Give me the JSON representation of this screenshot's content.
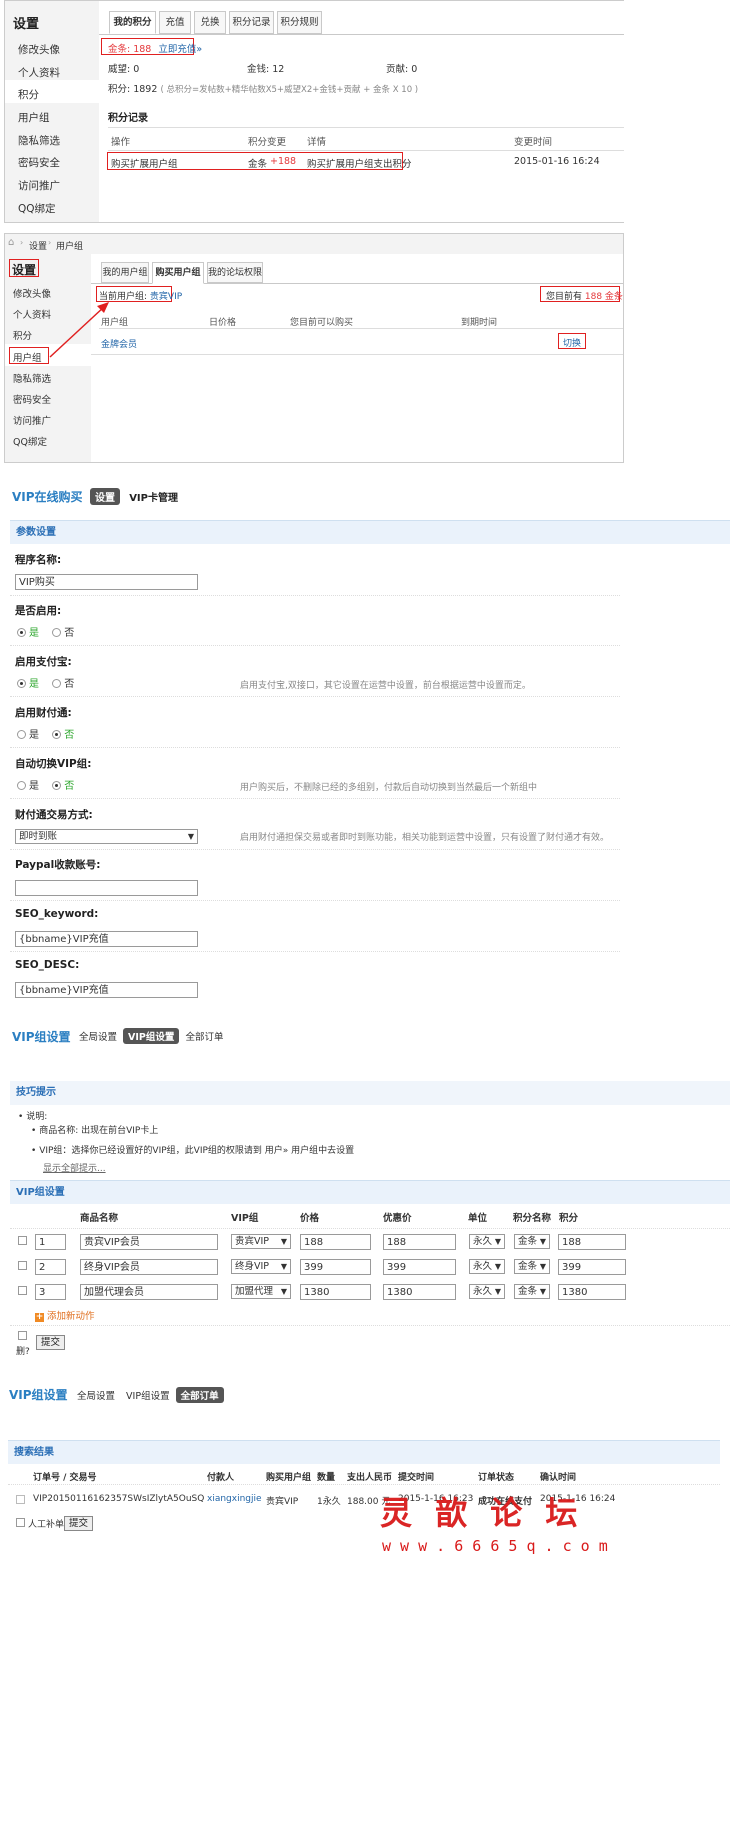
{
  "s1": {
    "sidebar_title": "设置",
    "sidebar_items": [
      "修改头像",
      "个人资料",
      "积分",
      "用户组",
      "隐私筛选",
      "密码安全",
      "访问推广",
      "QQ绑定"
    ],
    "tabs": [
      "我的积分",
      "充值",
      "兑换",
      "积分记录",
      "积分规则"
    ],
    "gold_label": "金条: 188",
    "recharge_link": "立即充值»",
    "weiwang": "威望: 0",
    "jinqian": "金钱: 12",
    "gongxian": "贡献: 0",
    "jifen_prefix": "积分: 1892",
    "jifen_formula": "( 总积分=发帖数+精华帖数X5+威望X2+金钱+贡献 + 金条 X 10 )",
    "record_title": "积分记录",
    "cols": [
      "操作",
      "积分变更",
      "详情",
      "变更时间"
    ],
    "row": {
      "op": "购买扩展用户组",
      "change_label": "金条",
      "change_val": "+188",
      "detail": "购买扩展用户组支出积分",
      "time": "2015-01-16 16:24"
    }
  },
  "s2": {
    "breadcrumb": [
      "设置",
      "用户组"
    ],
    "sidebar_title": "设置",
    "sidebar_items": [
      "修改头像",
      "个人资料",
      "积分",
      "用户组",
      "隐私筛选",
      "密码安全",
      "访问推广",
      "QQ绑定"
    ],
    "tabs": [
      "我的用户组",
      "购买用户组",
      "我的论坛权限"
    ],
    "current_label": "当前用户组:",
    "current_value": "贵宾VIP",
    "have_label": "您目前有",
    "have_value": "188 金条",
    "cols": [
      "用户组",
      "日价格",
      "您目前可以购买",
      "到期时间"
    ],
    "row_group": "金牌会员",
    "switch_btn": "切换"
  },
  "s3": {
    "title": "VIP在线购买",
    "tab_active": "设置",
    "tab_other": "VIP卡管理",
    "section": "参数设置",
    "f1_label": "程序名称:",
    "f1_value": "VIP购买",
    "f2_label": "是否启用:",
    "yes": "是",
    "no": "否",
    "f3_label": "启用支付宝:",
    "f3_hint": "启用支付宝,双接口，其它设置在运营中设置，前台根据运营中设置而定。",
    "f4_label": "启用财付通:",
    "f5_label": "自动切换VIP组:",
    "f5_hint": "用户购买后，不删除已经的多组别，付款后自动切换到当然最后一个新组中",
    "f6_label": "财付通交易方式:",
    "f6_value": "即时到账",
    "f6_hint": "启用财付通担保交易或者即时到账功能，相关功能到运营中设置，只有设置了财付通才有效。",
    "f7_label": "Paypal收款账号:",
    "f7_value": "",
    "f8_label": "SEO_keyword:",
    "f8_value": "{bbname}VIP充值",
    "f9_label": "SEO_DESC:",
    "f9_value": "{bbname}VIP充值"
  },
  "s4": {
    "title": "VIP组设置",
    "tab1": "全局设置",
    "tab2": "VIP组设置",
    "tab3": "全部订单",
    "tips_title": "技巧提示",
    "tip_head": "说明:",
    "tip1": "商品名称: 出现在前台VIP卡上",
    "tip2": "VIP组：选择你已经设置好的VIP组，此VIP组的权限请到 用户» 用户组中去设置",
    "tip_more": "显示全部提示...",
    "section": "VIP组设置",
    "cols": [
      "商品名称",
      "VIP组",
      "价格",
      "优惠价",
      "单位",
      "积分名称",
      "积分"
    ],
    "rows": [
      {
        "no": "1",
        "name": "贵宾VIP会员",
        "group": "贵宾VIP",
        "price": "188",
        "sale": "188",
        "unit": "永久",
        "credit_name": "金条",
        "credit": "188"
      },
      {
        "no": "2",
        "name": "终身VIP会员",
        "group": "终身VIP",
        "price": "399",
        "sale": "399",
        "unit": "永久",
        "credit_name": "金条",
        "credit": "399"
      },
      {
        "no": "3",
        "name": "加盟代理会员",
        "group": "加盟代理",
        "price": "1380",
        "sale": "1380",
        "unit": "永久",
        "credit_name": "金条",
        "credit": "1380"
      }
    ],
    "add_link": "添加新动作",
    "del_label": "删?",
    "submit": "提交"
  },
  "s5": {
    "title": "VIP组设置",
    "tab1": "全局设置",
    "tab2": "VIP组设置",
    "tab3": "全部订单",
    "section": "搜索结果",
    "cols": [
      "订单号 / 交易号",
      "付款人",
      "购买用户组",
      "数量",
      "支出人民币",
      "提交时间",
      "订单状态",
      "确认时间"
    ],
    "row": {
      "order": "VIP20150116162357SWsIZlytA5OuSQ",
      "payer": "xiangxingjie",
      "group": "贵宾VIP",
      "qty": "1永久",
      "rmb": "188.00 元",
      "submit": "2015-1-16 16:23",
      "status": "成功在线支付",
      "confirm": "2015-1-16 16:24"
    },
    "manual_label": "人工补单",
    "submit": "提交"
  },
  "watermark": {
    "text": "灵 歆 论 坛",
    "url": "w w w . 6 6 6 5 q . c o m"
  }
}
